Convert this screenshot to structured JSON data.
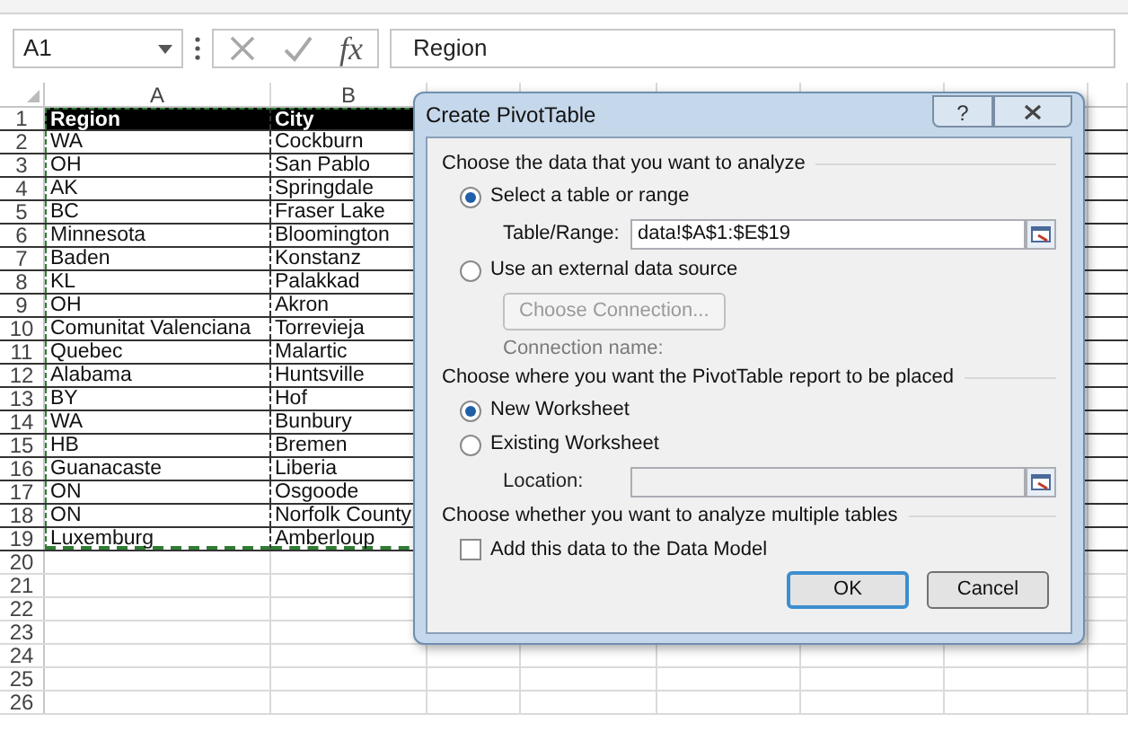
{
  "name_box": {
    "value": "A1"
  },
  "formula_bar": {
    "function_button": "fx",
    "value": "Region"
  },
  "sheet": {
    "columns": [
      "A",
      "B"
    ],
    "rows": [
      {
        "number": "1",
        "cells": [
          "Region",
          "City"
        ],
        "header": true
      },
      {
        "number": "2",
        "cells": [
          "WA",
          "Cockburn"
        ]
      },
      {
        "number": "3",
        "cells": [
          "OH",
          "San Pablo"
        ]
      },
      {
        "number": "4",
        "cells": [
          "AK",
          "Springdale"
        ]
      },
      {
        "number": "5",
        "cells": [
          "BC",
          "Fraser Lake"
        ]
      },
      {
        "number": "6",
        "cells": [
          "Minnesota",
          "Bloomington"
        ]
      },
      {
        "number": "7",
        "cells": [
          "Baden",
          "Konstanz"
        ]
      },
      {
        "number": "8",
        "cells": [
          "KL",
          "Palakkad"
        ]
      },
      {
        "number": "9",
        "cells": [
          "OH",
          "Akron"
        ]
      },
      {
        "number": "10",
        "cells": [
          "Comunitat Valenciana",
          "Torrevieja"
        ]
      },
      {
        "number": "11",
        "cells": [
          "Quebec",
          "Malartic"
        ]
      },
      {
        "number": "12",
        "cells": [
          "Alabama",
          "Huntsville"
        ]
      },
      {
        "number": "13",
        "cells": [
          "BY",
          "Hof"
        ]
      },
      {
        "number": "14",
        "cells": [
          "WA",
          "Bunbury"
        ]
      },
      {
        "number": "15",
        "cells": [
          "HB",
          "Bremen"
        ]
      },
      {
        "number": "16",
        "cells": [
          "Guanacaste",
          "Liberia"
        ]
      },
      {
        "number": "17",
        "cells": [
          "ON",
          "Osgoode"
        ]
      },
      {
        "number": "18",
        "cells": [
          "ON",
          "Norfolk County"
        ]
      },
      {
        "number": "19",
        "cells": [
          "Luxemburg",
          "Amberloup"
        ]
      },
      {
        "number": "20",
        "cells": []
      },
      {
        "number": "21",
        "cells": []
      },
      {
        "number": "22",
        "cells": []
      },
      {
        "number": "23",
        "cells": []
      },
      {
        "number": "24",
        "cells": []
      },
      {
        "number": "25",
        "cells": []
      },
      {
        "number": "26",
        "cells": []
      }
    ]
  },
  "dialog": {
    "title": "Create PivotTable",
    "help_button": "?",
    "sections": [
      {
        "heading": "Choose the data that you want to analyze",
        "items": [
          {
            "kind": "radio",
            "label": "Select a table or range",
            "selected": true
          },
          {
            "kind": "field",
            "label": "Table/Range:",
            "value": "data!$A$1:$E$19",
            "disabled": false
          },
          {
            "kind": "radio",
            "label": "Use an external data source",
            "selected": false
          },
          {
            "kind": "button",
            "label": "Choose Connection...",
            "disabled": true
          },
          {
            "kind": "note",
            "label": "Connection name:",
            "disabled": true
          }
        ]
      },
      {
        "heading": "Choose where you want the PivotTable report to be placed",
        "items": [
          {
            "kind": "radio",
            "label": "New Worksheet",
            "selected": true
          },
          {
            "kind": "radio",
            "label": "Existing Worksheet",
            "selected": false
          },
          {
            "kind": "field",
            "label": "Location:",
            "value": "",
            "disabled": true
          }
        ]
      },
      {
        "heading": "Choose whether you want to analyze multiple tables",
        "items": [
          {
            "kind": "checkbox",
            "label": "Add this data to the Data Model",
            "checked": false
          }
        ]
      }
    ],
    "buttons": [
      {
        "label": "OK",
        "default": true
      },
      {
        "label": "Cancel",
        "default": false
      }
    ]
  }
}
